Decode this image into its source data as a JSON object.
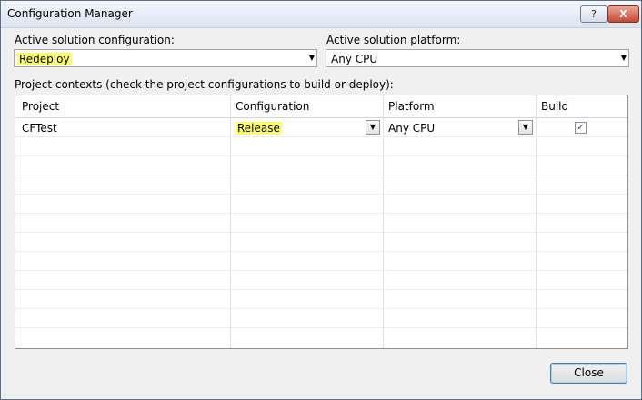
{
  "window": {
    "title": "Configuration Manager",
    "help_glyph": "?",
    "close_glyph": "X"
  },
  "solution_config": {
    "label": "Active solution configuration:",
    "value": "Redeploy"
  },
  "solution_platform": {
    "label": "Active solution platform:",
    "value": "Any CPU"
  },
  "contexts_label": "Project contexts (check the project configurations to build or deploy):",
  "columns": [
    "Project",
    "Configuration",
    "Platform",
    "Build"
  ],
  "rows": [
    {
      "project": "CFTest",
      "configuration": "Release",
      "platform": "Any CPU",
      "build": true
    }
  ],
  "check_glyph": "✓",
  "close_button": "Close",
  "colors": {
    "highlight": "#ffff66",
    "focus_border": "#3c7fb1"
  }
}
